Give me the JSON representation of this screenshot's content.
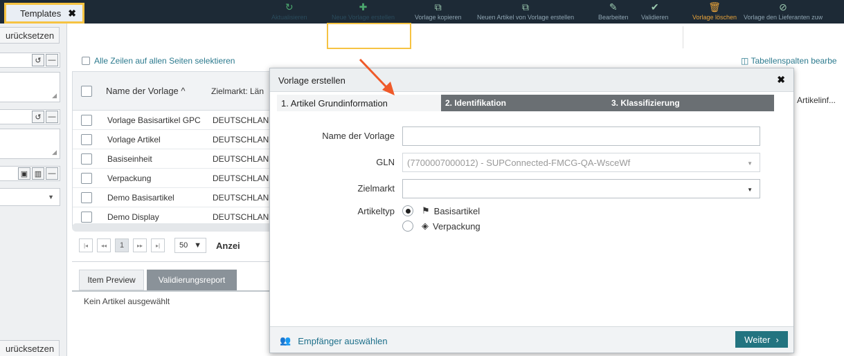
{
  "tabs": [
    {
      "label": "Templates",
      "close": "✖"
    }
  ],
  "left_panel": {
    "reset_label": "urücksetzen",
    "reset_bottom_label": "urücksetzen",
    "undo_icon": "↺",
    "minus_icon": "—"
  },
  "toolbar": {
    "items": [
      {
        "label": "Aktualisieren",
        "icon": "refresh-icon",
        "glyph": "↻"
      },
      {
        "label": "Neue Vorlage erstellen",
        "icon": "plus-icon",
        "glyph": "✚"
      },
      {
        "label": "Vorlage kopieren",
        "icon": "copy-icon",
        "glyph": "⧉"
      },
      {
        "label": "Neuen Artikel von Vorlage erstellen",
        "icon": "copy-icon",
        "glyph": "⧉"
      },
      {
        "label": "Bearbeiten",
        "icon": "pencil-icon",
        "glyph": "✎"
      },
      {
        "label": "Validieren",
        "icon": "check-icon",
        "glyph": "✔"
      },
      {
        "label": "Vorlage löschen",
        "icon": "trash-icon",
        "glyph": "🗑"
      },
      {
        "label": "Vorlage den Lieferanten zuw",
        "icon": "tag-icon",
        "glyph": "⊘"
      }
    ]
  },
  "grid": {
    "select_all": "Alle Zeilen auf allen Seiten selektieren",
    "column_settings": "Tabellenspalten bearbe",
    "columns": [
      "Name der Vorlage ^",
      "Zielmarkt: Län"
    ],
    "rows": [
      {
        "name": "Vorlage Basisartikel GPC",
        "market": "DEUTSCHLAN"
      },
      {
        "name": "Vorlage Artikel",
        "market": "DEUTSCHLAN"
      },
      {
        "name": "Basiseinheit",
        "market": "DEUTSCHLAN"
      },
      {
        "name": "Verpackung",
        "market": "DEUTSCHLAN"
      },
      {
        "name": "Demo Basisartikel",
        "market": "DEUTSCHLAN"
      },
      {
        "name": "Demo Display",
        "market": "DEUTSCHLAN"
      }
    ],
    "right_header": "Artikelinf...",
    "pager": {
      "first": "|◂",
      "prev": "◂◂",
      "page": "1",
      "next": "▸▸",
      "last": "▸|",
      "size": "50",
      "count_label": "Anzei"
    }
  },
  "bottom_tabs": {
    "preview": "Item Preview",
    "report": "Validierungsreport",
    "empty_text": "Kein Artikel ausgewählt"
  },
  "modal": {
    "title": "Vorlage erstellen",
    "close": "✖",
    "steps": [
      "1. Artikel Grundinformation",
      "2. Identifikation",
      "3. Klassifizierung"
    ],
    "fields": {
      "name_label": "Name der Vorlage",
      "name_value": "",
      "gln_label": "GLN",
      "gln_value": "(7700007000012) - SUPConnected-FMCG-QA-WsceWf",
      "market_label": "Zielmarkt",
      "market_value": "",
      "type_label": "Artikeltyp",
      "type_options": [
        {
          "label": "Basisartikel",
          "selected": true
        },
        {
          "label": "Verpackung",
          "selected": false
        }
      ]
    },
    "recipients": "Empfänger auswählen",
    "next": "Weiter",
    "next_icon": "›"
  },
  "colors": {
    "accent": "#237480",
    "highlight": "#f6c342",
    "annotation_arrow": "#ef5a2a",
    "tab_bar": "#1d2a36"
  }
}
